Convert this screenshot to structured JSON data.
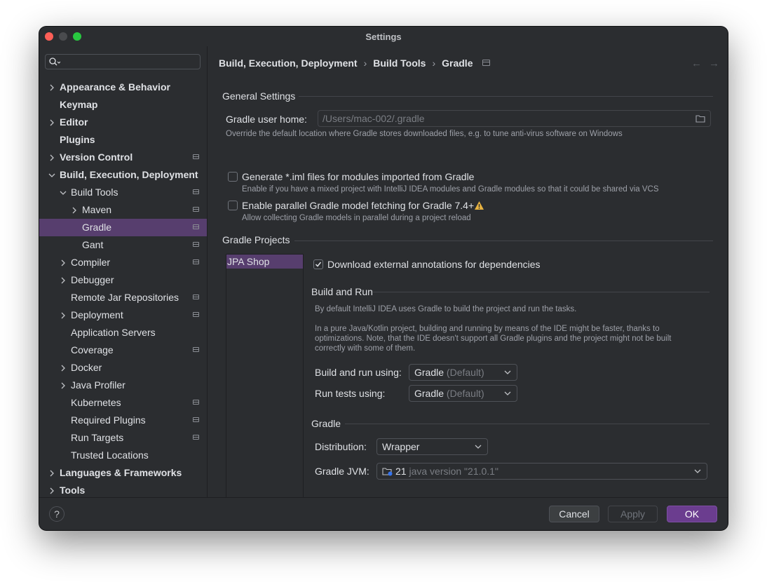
{
  "window": {
    "title": "Settings"
  },
  "search": {
    "placeholder": ""
  },
  "sidebar": {
    "items": [
      {
        "label": "Appearance & Behavior",
        "indent": 0,
        "expandable": true,
        "expanded": false,
        "bold": true,
        "icon": false
      },
      {
        "label": "Keymap",
        "indent": 0,
        "expandable": false,
        "bold": true,
        "icon": false
      },
      {
        "label": "Editor",
        "indent": 0,
        "expandable": true,
        "expanded": false,
        "bold": true,
        "icon": false
      },
      {
        "label": "Plugins",
        "indent": 0,
        "expandable": false,
        "bold": true,
        "icon": false
      },
      {
        "label": "Version Control",
        "indent": 0,
        "expandable": true,
        "expanded": false,
        "bold": true,
        "icon": true
      },
      {
        "label": "Build, Execution, Deployment",
        "indent": 0,
        "expandable": true,
        "expanded": true,
        "bold": true,
        "icon": false
      },
      {
        "label": "Build Tools",
        "indent": 1,
        "expandable": true,
        "expanded": true,
        "bold": false,
        "icon": true
      },
      {
        "label": "Maven",
        "indent": 2,
        "expandable": true,
        "expanded": false,
        "bold": false,
        "icon": true
      },
      {
        "label": "Gradle",
        "indent": 2,
        "expandable": false,
        "bold": false,
        "icon": true,
        "selected": true
      },
      {
        "label": "Gant",
        "indent": 2,
        "expandable": false,
        "bold": false,
        "icon": true
      },
      {
        "label": "Compiler",
        "indent": 1,
        "expandable": true,
        "expanded": false,
        "bold": false,
        "icon": true
      },
      {
        "label": "Debugger",
        "indent": 1,
        "expandable": true,
        "expanded": false,
        "bold": false,
        "icon": false
      },
      {
        "label": "Remote Jar Repositories",
        "indent": 1,
        "expandable": false,
        "bold": false,
        "icon": true
      },
      {
        "label": "Deployment",
        "indent": 1,
        "expandable": true,
        "expanded": false,
        "bold": false,
        "icon": true
      },
      {
        "label": "Application Servers",
        "indent": 1,
        "expandable": false,
        "bold": false,
        "icon": false
      },
      {
        "label": "Coverage",
        "indent": 1,
        "expandable": false,
        "bold": false,
        "icon": true
      },
      {
        "label": "Docker",
        "indent": 1,
        "expandable": true,
        "expanded": false,
        "bold": false,
        "icon": false
      },
      {
        "label": "Java Profiler",
        "indent": 1,
        "expandable": true,
        "expanded": false,
        "bold": false,
        "icon": false
      },
      {
        "label": "Kubernetes",
        "indent": 1,
        "expandable": false,
        "bold": false,
        "icon": true
      },
      {
        "label": "Required Plugins",
        "indent": 1,
        "expandable": false,
        "bold": false,
        "icon": true
      },
      {
        "label": "Run Targets",
        "indent": 1,
        "expandable": false,
        "bold": false,
        "icon": true
      },
      {
        "label": "Trusted Locations",
        "indent": 1,
        "expandable": false,
        "bold": false,
        "icon": false
      },
      {
        "label": "Languages & Frameworks",
        "indent": 0,
        "expandable": true,
        "expanded": false,
        "bold": true,
        "icon": false
      },
      {
        "label": "Tools",
        "indent": 0,
        "expandable": true,
        "expanded": false,
        "bold": true,
        "icon": false
      }
    ]
  },
  "breadcrumb": {
    "parts": [
      "Build, Execution, Deployment",
      "Build Tools",
      "Gradle"
    ],
    "sep": "›",
    "back": "←",
    "forward": "→"
  },
  "general": {
    "title": "General Settings",
    "user_home_label": "Gradle user home:",
    "user_home_value": "/Users/mac-002/.gradle",
    "user_home_hint": "Override the default location where Gradle stores downloaded files, e.g. to tune anti-virus software on Windows",
    "iml_label": "Generate *.iml files for modules imported from Gradle",
    "iml_checked": false,
    "iml_hint": "Enable if you have a mixed project with IntelliJ IDEA modules and Gradle modules so that it could be shared via VCS",
    "parallel_label": "Enable parallel Gradle model fetching for Gradle 7.4+",
    "parallel_checked": false,
    "parallel_hint": "Allow collecting Gradle models in parallel during a project reload"
  },
  "projects": {
    "title": "Gradle Projects",
    "items": [
      "JPA Shop"
    ],
    "annotations_label": "Download external annotations for dependencies",
    "annotations_checked": true,
    "build_run_title": "Build and Run",
    "build_run_hint1": "By default IntelliJ IDEA uses Gradle to build the project and run the tasks.",
    "build_run_hint2_lines": [
      "In a pure Java/Kotlin project, building and running by means of the IDE might be faster, thanks to",
      "optimizations. Note, that the IDE doesn't support all Gradle plugins and the project might not be built",
      "correctly with some of them."
    ],
    "build_using_label": "Build and run using:",
    "build_using_value": "Gradle",
    "build_using_suffix": "(Default)",
    "tests_using_label": "Run tests using:",
    "tests_using_value": "Gradle",
    "tests_using_suffix": "(Default)",
    "gradle_title": "Gradle",
    "distribution_label": "Distribution:",
    "distribution_value": "Wrapper",
    "jvm_label": "Gradle JVM:",
    "jvm_value": "21",
    "jvm_detail": "java version \"21.0.1\""
  },
  "footer": {
    "help": "?",
    "cancel": "Cancel",
    "apply": "Apply",
    "ok": "OK"
  },
  "colors": {
    "selection": "#573e6e",
    "ok_button": "#6b3d8f",
    "warning": "#e8b341",
    "background": "#2b2d30"
  }
}
